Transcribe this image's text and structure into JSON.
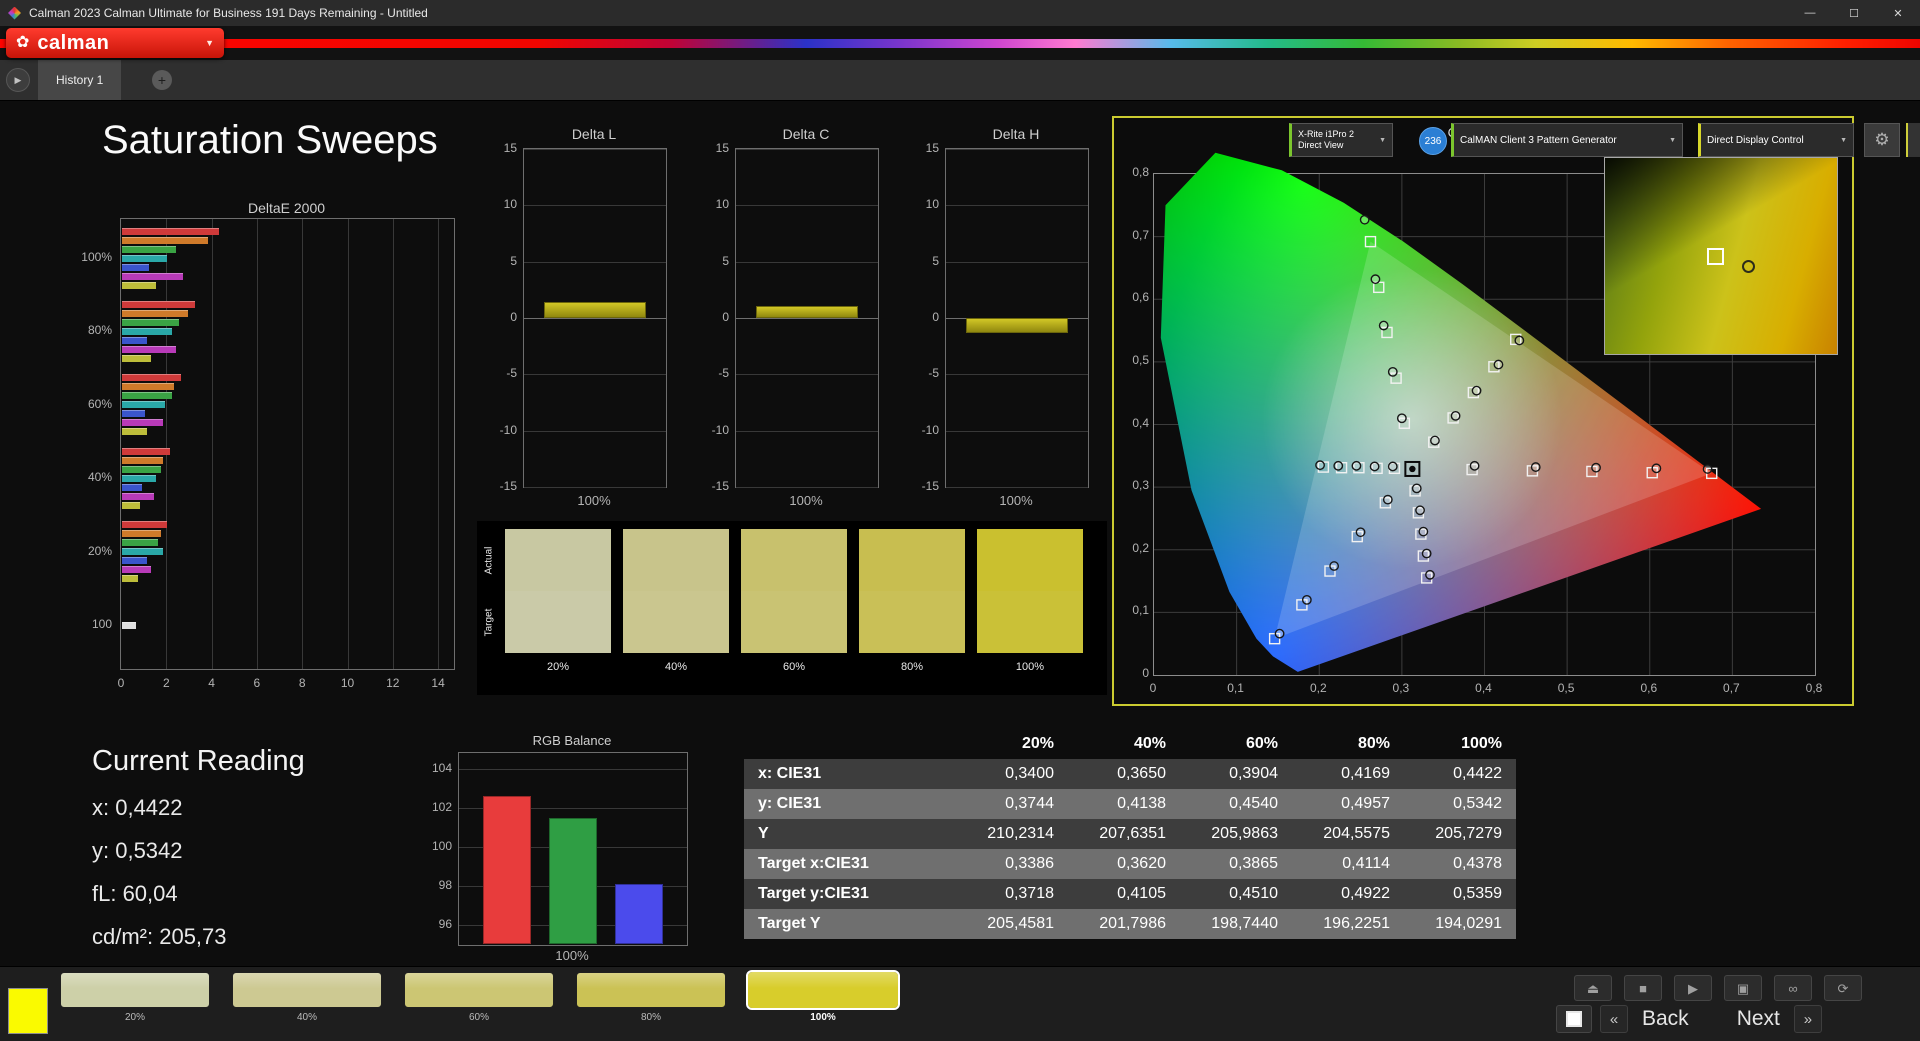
{
  "window": {
    "title": "Calman 2023 Calman Ultimate for Business 191 Days Remaining  - Untitled"
  },
  "icons": {
    "minimize": "—",
    "maximize": "☐",
    "close": "✕",
    "chevron_down": "▼",
    "gear": "⚙",
    "plus": "+",
    "history_arrow": "▶",
    "logo_flower": "✿",
    "eject": "⏏",
    "stop": "■",
    "play": "▶",
    "save": "▣",
    "link": "∞",
    "refresh": "⟳",
    "prev_chevron": "«",
    "next_chevron": "»"
  },
  "logo": {
    "text": "calman"
  },
  "tab_bar": {
    "history_tab": "History 1",
    "meter": {
      "line1": "X-Rite i1Pro 2",
      "line2": "Direct View",
      "accent": "#7bc62d"
    },
    "badge": "236",
    "pattern_generator": {
      "label": "CalMAN Client 3 Pattern Generator",
      "accent": "#7bc62d"
    },
    "display_control": {
      "label": "Direct Display Control",
      "accent": "#d7d72a"
    }
  },
  "page": {
    "title": "Saturation Sweeps"
  },
  "current_reading": {
    "title": "Current Reading",
    "lines": [
      "x: 0,4422",
      "y: 0,5342",
      "fL: 60,04",
      "cd/m²: 205,73"
    ]
  },
  "bottom_bar": {
    "patch_color": "#fafa00",
    "swatches": [
      {
        "label": "20%",
        "color": "#cdd0a8",
        "selected": false
      },
      {
        "label": "40%",
        "color": "#cdc992",
        "selected": false
      },
      {
        "label": "60%",
        "color": "#ccc673",
        "selected": false
      },
      {
        "label": "80%",
        "color": "#cbc255",
        "selected": false
      },
      {
        "label": "100%",
        "color": "#d8cd2b",
        "selected": true
      }
    ],
    "transport": [
      "eject",
      "stop",
      "play",
      "save",
      "link",
      "refresh"
    ],
    "back_label": "Back",
    "next_label": "Next"
  },
  "chart_data": [
    {
      "name": "deltae2000",
      "type": "bar",
      "title": "DeltaE 2000",
      "xlim": [
        0,
        14.7
      ],
      "xticks": [
        0,
        2,
        4,
        6,
        8,
        10,
        12,
        14
      ],
      "groups": [
        {
          "label": "100%",
          "values": [
            4.3,
            3.8,
            2.4,
            2.0,
            1.2,
            2.7,
            1.5
          ]
        },
        {
          "label": "80%",
          "values": [
            3.2,
            2.9,
            2.5,
            2.2,
            1.1,
            2.4,
            1.3
          ]
        },
        {
          "label": "60%",
          "values": [
            2.6,
            2.3,
            2.2,
            1.9,
            1.0,
            1.8,
            1.1
          ]
        },
        {
          "label": "40%",
          "values": [
            2.1,
            1.8,
            1.7,
            1.5,
            0.9,
            1.4,
            0.8
          ]
        },
        {
          "label": "20%",
          "values": [
            2.0,
            1.7,
            1.6,
            1.8,
            1.1,
            1.3,
            0.7
          ]
        },
        {
          "label": "100",
          "values": [
            0.6
          ]
        }
      ],
      "bar_colors": [
        "#cf3a3a",
        "#cf7a2a",
        "#3aa344",
        "#2aa8a8",
        "#3a55cc",
        "#b83ab8",
        "#bdbd3a"
      ],
      "single_bar_color": "#e0e0e0"
    },
    {
      "name": "delta_l",
      "type": "bar",
      "title": "Delta L",
      "ylim": [
        -15,
        15
      ],
      "yticks": [
        15,
        10,
        5,
        0,
        -5,
        -10,
        -15
      ],
      "xlabel": "100%",
      "value": 1.4,
      "color": "#c2b81f"
    },
    {
      "name": "delta_c",
      "type": "bar",
      "title": "Delta C",
      "ylim": [
        -15,
        15
      ],
      "yticks": [
        15,
        10,
        5,
        0,
        -5,
        -10,
        -15
      ],
      "xlabel": "100%",
      "value": 1.1,
      "color": "#c2b81f"
    },
    {
      "name": "delta_h",
      "type": "bar",
      "title": "Delta H",
      "ylim": [
        -15,
        15
      ],
      "yticks": [
        15,
        10,
        5,
        0,
        -5,
        -10,
        -15
      ],
      "xlabel": "100%",
      "value": -1.3,
      "color": "#c2b81f"
    },
    {
      "name": "rgb_balance",
      "type": "bar",
      "title": "RGB Balance",
      "ylim": [
        95,
        104.8
      ],
      "yticks": [
        104,
        102,
        100,
        98,
        96
      ],
      "xlabel": "100%",
      "series": [
        {
          "name": "red",
          "value": 102.6,
          "color": "#e83c3c"
        },
        {
          "name": "green",
          "value": 101.5,
          "color": "#2f9e44"
        },
        {
          "name": "blue",
          "value": 98.1,
          "color": "#4b4bec"
        }
      ]
    },
    {
      "name": "cie1931",
      "type": "scatter",
      "title": "CIE 1931 xy",
      "xlim": [
        0,
        0.8
      ],
      "ylim": [
        0,
        0.8
      ],
      "ticks": [
        0,
        0.1,
        0.2,
        0.3,
        0.4,
        0.5,
        0.6,
        0.7,
        0.8
      ],
      "selected_point": [
        0.3127,
        0.329
      ],
      "sweeps": [
        {
          "color": "yellow",
          "target": [
            [
              0.3386,
              0.3718
            ],
            [
              0.362,
              0.4105
            ],
            [
              0.3865,
              0.451
            ],
            [
              0.4114,
              0.4922
            ],
            [
              0.4378,
              0.5359
            ]
          ],
          "measured": [
            [
              0.34,
              0.3744
            ],
            [
              0.365,
              0.4138
            ],
            [
              0.3904,
              0.454
            ],
            [
              0.4169,
              0.4957
            ],
            [
              0.4422,
              0.5342
            ]
          ]
        },
        {
          "color": "red",
          "target": [
            [
              0.385,
              0.328
            ],
            [
              0.458,
              0.326
            ],
            [
              0.53,
              0.325
            ],
            [
              0.603,
              0.323
            ],
            [
              0.675,
              0.322
            ]
          ],
          "measured": [
            [
              0.388,
              0.334
            ],
            [
              0.462,
              0.332
            ],
            [
              0.535,
              0.331
            ],
            [
              0.608,
              0.33
            ],
            [
              0.67,
              0.329
            ]
          ]
        },
        {
          "color": "green",
          "target": [
            [
              0.303,
              0.402
            ],
            [
              0.293,
              0.474
            ],
            [
              0.282,
              0.547
            ],
            [
              0.272,
              0.619
            ],
            [
              0.262,
              0.692
            ]
          ],
          "measured": [
            [
              0.3,
              0.41
            ],
            [
              0.289,
              0.484
            ],
            [
              0.278,
              0.558
            ],
            [
              0.268,
              0.632
            ],
            [
              0.255,
              0.727
            ]
          ]
        },
        {
          "color": "blue",
          "target": [
            [
              0.28,
              0.275
            ],
            [
              0.246,
              0.221
            ],
            [
              0.213,
              0.166
            ],
            [
              0.179,
              0.112
            ],
            [
              0.146,
              0.058
            ]
          ],
          "measured": [
            [
              0.283,
              0.28
            ],
            [
              0.25,
              0.228
            ],
            [
              0.218,
              0.174
            ],
            [
              0.185,
              0.12
            ],
            [
              0.152,
              0.066
            ]
          ]
        },
        {
          "color": "cyan",
          "target": [
            [
              0.291,
              0.33
            ],
            [
              0.27,
              0.33
            ],
            [
              0.248,
              0.331
            ],
            [
              0.227,
              0.331
            ],
            [
              0.205,
              0.332
            ]
          ],
          "measured": [
            [
              0.289,
              0.333
            ],
            [
              0.267,
              0.333
            ],
            [
              0.245,
              0.334
            ],
            [
              0.223,
              0.334
            ],
            [
              0.201,
              0.335
            ]
          ]
        },
        {
          "color": "magenta",
          "target": [
            [
              0.316,
              0.294
            ],
            [
              0.32,
              0.259
            ],
            [
              0.323,
              0.225
            ],
            [
              0.326,
              0.19
            ],
            [
              0.33,
              0.155
            ]
          ],
          "measured": [
            [
              0.318,
              0.298
            ],
            [
              0.322,
              0.263
            ],
            [
              0.326,
              0.229
            ],
            [
              0.33,
              0.194
            ],
            [
              0.334,
              0.16
            ]
          ]
        }
      ]
    },
    {
      "name": "results_table",
      "type": "table",
      "headers": [
        "",
        "20%",
        "40%",
        "60%",
        "80%",
        "100%"
      ],
      "rows": [
        {
          "label": "x: CIE31",
          "values": [
            "0,3400",
            "0,3650",
            "0,3904",
            "0,4169",
            "0,4422"
          ]
        },
        {
          "label": "y: CIE31",
          "values": [
            "0,3744",
            "0,4138",
            "0,4540",
            "0,4957",
            "0,5342"
          ]
        },
        {
          "label": "Y",
          "values": [
            "210,2314",
            "207,6351",
            "205,9863",
            "204,5575",
            "205,7279"
          ]
        },
        {
          "label": "Target x:CIE31",
          "values": [
            "0,3386",
            "0,3620",
            "0,3865",
            "0,4114",
            "0,4378"
          ]
        },
        {
          "label": "Target y:CIE31",
          "values": [
            "0,3718",
            "0,4105",
            "0,4510",
            "0,4922",
            "0,5359"
          ]
        },
        {
          "label": "Target Y",
          "values": [
            "205,4581",
            "201,7986",
            "198,7440",
            "196,2251",
            "194,0291"
          ]
        }
      ]
    },
    {
      "name": "saturation_swatches",
      "type": "swatches",
      "row_labels": [
        "Actual",
        "Target"
      ],
      "levels": [
        {
          "label": "20%",
          "actual": "#c8c8a2",
          "target": "#cacaa8"
        },
        {
          "label": "40%",
          "actual": "#c8c48b",
          "target": "#cac68f"
        },
        {
          "label": "60%",
          "actual": "#c8c16d",
          "target": "#c9c373"
        },
        {
          "label": "80%",
          "actual": "#c8be50",
          "target": "#c9c057"
        },
        {
          "label": "100%",
          "actual": "#cac02f",
          "target": "#cac137"
        }
      ]
    }
  ]
}
